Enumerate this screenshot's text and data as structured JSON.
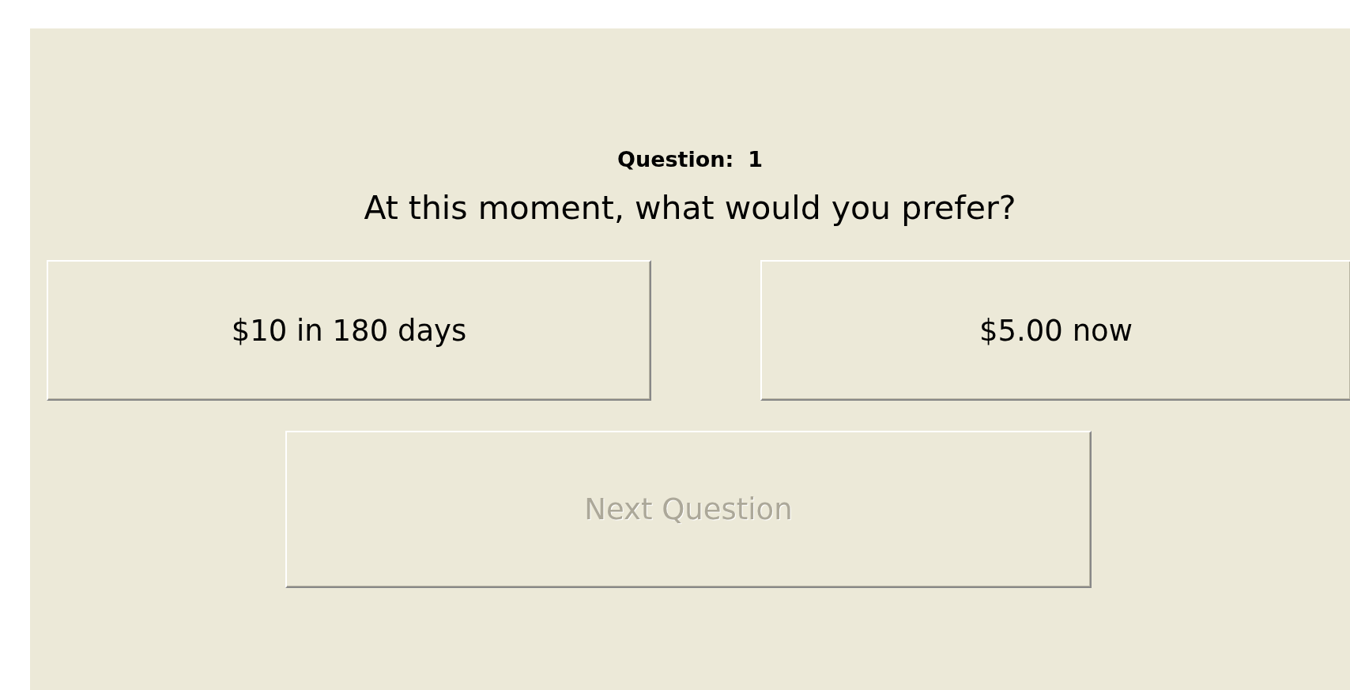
{
  "question_label": "Question:",
  "question_number": "1",
  "prompt": "At this moment, what would you prefer?",
  "choices": [
    {
      "label": "$10 in 180 days"
    },
    {
      "label": "$5.00 now"
    }
  ],
  "next_button": {
    "label": "Next Question",
    "disabled": true
  }
}
